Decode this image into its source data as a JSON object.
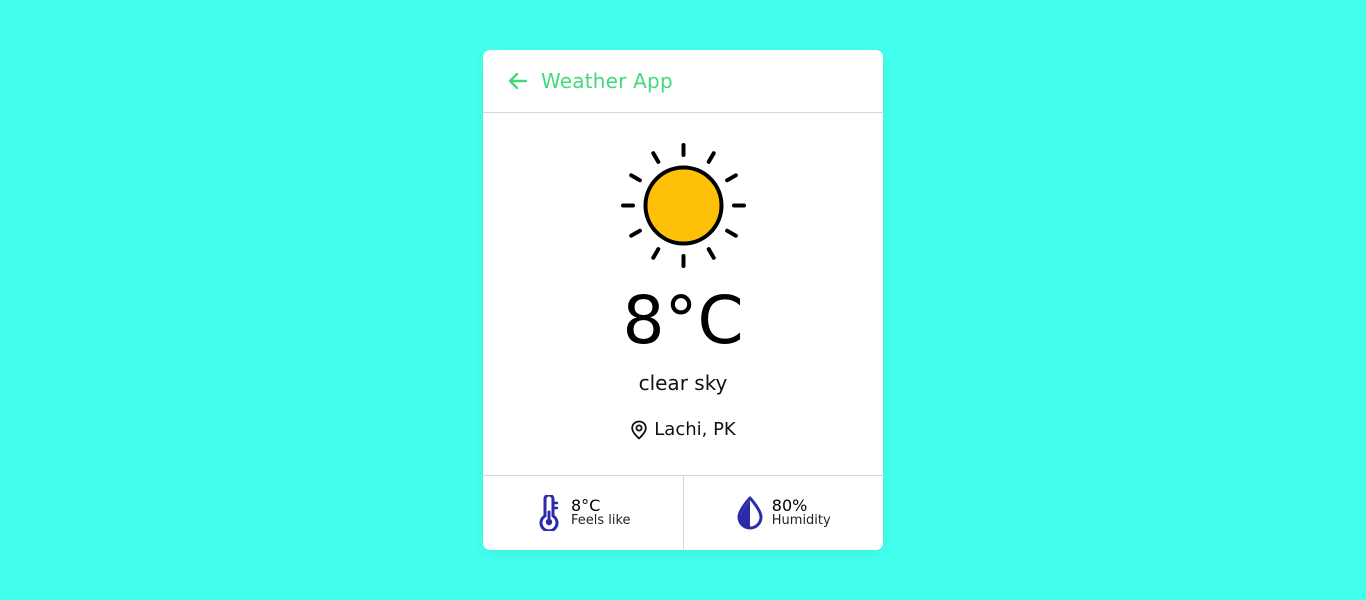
{
  "header": {
    "title": "Weather App",
    "back_icon": "arrow-left-icon"
  },
  "weather": {
    "icon": "sun-icon",
    "temperature": "8°C",
    "description": "clear sky",
    "location": "Lachi, PK",
    "location_icon": "map-pin-icon"
  },
  "details": {
    "feels_like": {
      "icon": "thermometer-icon",
      "value": "8°C",
      "label": "Feels like"
    },
    "humidity": {
      "icon": "droplet-icon",
      "value": "80%",
      "label": "Humidity"
    }
  },
  "colors": {
    "background": "#43ffee",
    "accent": "#43d97b",
    "sun": "#ffc107",
    "icon_blue": "#2b2aa8"
  }
}
